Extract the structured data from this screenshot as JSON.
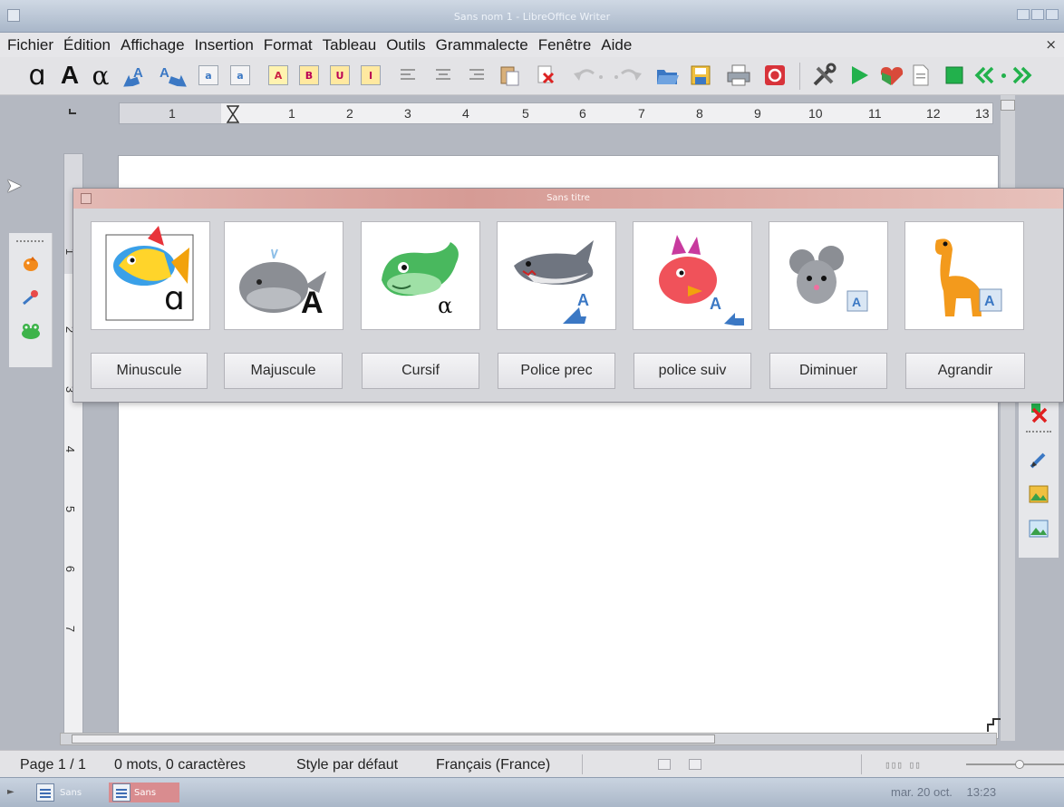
{
  "window": {
    "title": "Sans nom 1 - LibreOffice Writer"
  },
  "menu": [
    {
      "label": "Fichier"
    },
    {
      "label": "Édition"
    },
    {
      "label": "Affichage"
    },
    {
      "label": "Insertion"
    },
    {
      "label": "Format"
    },
    {
      "label": "Tableau"
    },
    {
      "label": "Outils"
    },
    {
      "label": "Grammalecte"
    },
    {
      "label": "Fenêtre"
    },
    {
      "label": "Aide"
    }
  ],
  "menu_close": "×",
  "toolbar": {
    "glyph_lower": "ɑ",
    "glyph_upper": "A",
    "glyph_cursive": "α"
  },
  "ruler": {
    "h": [
      "1",
      "1",
      "2",
      "3",
      "4",
      "5",
      "6",
      "7",
      "8",
      "9",
      "10",
      "11",
      "12",
      "13"
    ],
    "v": [
      "1",
      "2",
      "3",
      "4",
      "5",
      "6",
      "7"
    ]
  },
  "dialog": {
    "title": "Sans titre",
    "buttons": [
      {
        "label": "Minuscule"
      },
      {
        "label": "Majuscule"
      },
      {
        "label": "Cursif"
      },
      {
        "label": "Police prec"
      },
      {
        "label": "police suiv"
      },
      {
        "label": "Diminuer"
      },
      {
        "label": "Agrandir"
      }
    ],
    "card_glyphs": [
      "ɑ",
      "A",
      "α"
    ]
  },
  "status": {
    "page": "Page 1 / 1",
    "words": "0 mots, 0 caractères",
    "style": "Style par défaut",
    "language": "Français (France)"
  },
  "taskbar": {
    "tasks": [
      {
        "label": "Sans"
      },
      {
        "label": "Sans"
      }
    ],
    "date": "mar. 20 oct.",
    "time": "13:23"
  },
  "colors": {
    "dialog_title": "#d69b95",
    "green_accent": "#22b14c",
    "blue_arrow": "#3b78c4"
  }
}
